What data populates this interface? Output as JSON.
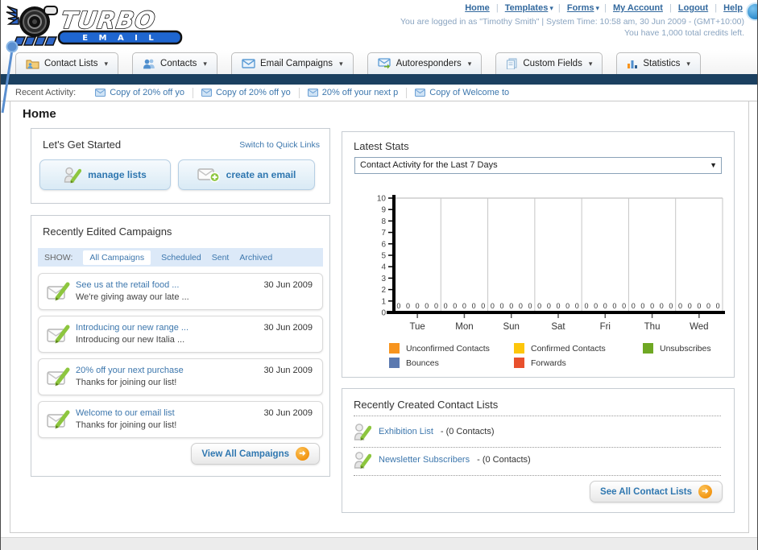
{
  "header": {
    "separator": "|",
    "nav_links": [
      "Home",
      "Templates",
      "Forms",
      "My Account",
      "Logout",
      "Help"
    ],
    "login_line": "You are logged in as \"Timothy Smith\" | System Time: 10:58 am, 30 Jun 2009 - (GMT+10:00)",
    "credits_line": "You have 1,000 total credits left.",
    "logo_title": "TURBO",
    "logo_subtitle": "E M A I L"
  },
  "tabs": [
    {
      "label": "Contact Lists"
    },
    {
      "label": "Contacts"
    },
    {
      "label": "Email Campaigns"
    },
    {
      "label": "Autoresponders"
    },
    {
      "label": "Custom Fields"
    },
    {
      "label": "Statistics"
    }
  ],
  "recent_activity": {
    "label": "Recent Activity:",
    "items": [
      "Copy of 20% off yo",
      "Copy of 20% off yo",
      "20% off your next p",
      "Copy of Welcome to"
    ]
  },
  "page_title": "Home",
  "get_started": {
    "title": "Let's Get Started",
    "switch_link": "Switch to Quick Links",
    "manage_lists_label": "manage lists",
    "create_email_label": "create an email"
  },
  "campaigns": {
    "title": "Recently Edited Campaigns",
    "show_label": "SHOW:",
    "filters": [
      "All Campaigns",
      "Scheduled",
      "Sent",
      "Archived"
    ],
    "active_filter": "All Campaigns",
    "items": [
      {
        "title": "See us at the retail food ...",
        "subtitle": "We're giving away our late ...",
        "date": "30 Jun 2009"
      },
      {
        "title": "Introducing our new range ...",
        "subtitle": "Introducing our new Italia ...",
        "date": "30 Jun 2009"
      },
      {
        "title": "20% off your next purchase",
        "subtitle": "Thanks for joining our list!",
        "date": "30 Jun 2009"
      },
      {
        "title": "Welcome to our email list",
        "subtitle": "Thanks for joining our list!",
        "date": "30 Jun 2009"
      }
    ],
    "view_all_label": "View All Campaigns"
  },
  "stats": {
    "title": "Latest Stats",
    "dropdown_value": "Contact Activity for the Last 7 Days"
  },
  "contact_lists_panel": {
    "title": "Recently Created Contact Lists",
    "items": [
      {
        "name": "Exhibition List",
        "detail": "- (0 Contacts)"
      },
      {
        "name": "Newsletter Subscribers",
        "detail": "- (0 Contacts)"
      }
    ],
    "see_all_label": "See All Contact Lists"
  },
  "chart_data": {
    "type": "bar",
    "title": "Contact Activity for the Last 7 Days",
    "categories": [
      "Tue",
      "Mon",
      "Sun",
      "Sat",
      "Fri",
      "Thu",
      "Wed"
    ],
    "series": [
      {
        "name": "Unconfirmed Contacts",
        "color": "#f7941e",
        "values": [
          0,
          0,
          0,
          0,
          0,
          0,
          0
        ]
      },
      {
        "name": "Confirmed Contacts",
        "color": "#fdc60b",
        "values": [
          0,
          0,
          0,
          0,
          0,
          0,
          0
        ]
      },
      {
        "name": "Unsubscribes",
        "color": "#6fa824",
        "values": [
          0,
          0,
          0,
          0,
          0,
          0,
          0
        ]
      },
      {
        "name": "Bounces",
        "color": "#5b79b0",
        "values": [
          0,
          0,
          0,
          0,
          0,
          0,
          0
        ]
      },
      {
        "name": "Forwards",
        "color": "#e8502d",
        "values": [
          0,
          0,
          0,
          0,
          0,
          0,
          0
        ]
      }
    ],
    "ylim": [
      0,
      10
    ],
    "yticks": [
      0,
      1,
      2,
      3,
      4,
      5,
      6,
      7,
      8,
      9,
      10
    ],
    "xlabel": "",
    "ylabel": "",
    "grid": "vertical",
    "legend_position": "bottom"
  },
  "icons": {
    "dropdown_arrow": "▾",
    "select_arrow": "▼",
    "right_arrow": "➜"
  },
  "colors": {
    "accent_blue": "#3d77ad",
    "navy_bar": "#1b4060",
    "filter_bg": "#dce9f8",
    "button_text": "#2f77b0",
    "orange_arrow": "#f59c1a"
  }
}
